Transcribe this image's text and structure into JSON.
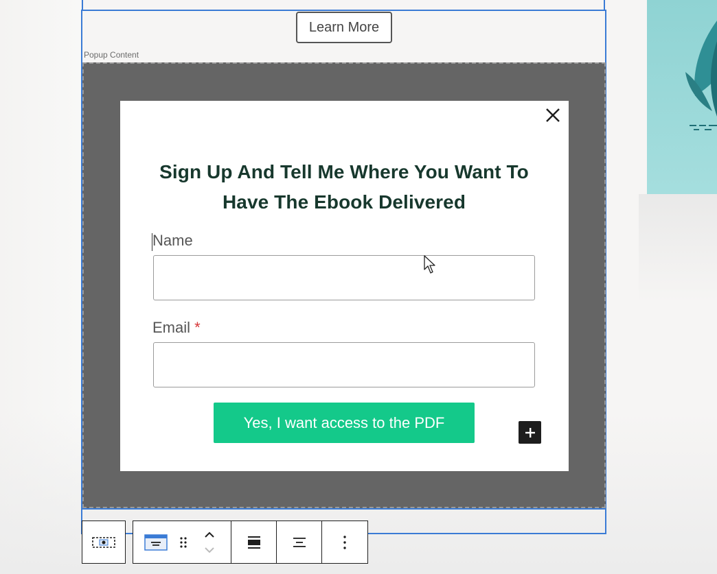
{
  "learn_more": {
    "label": "Learn More"
  },
  "popup_area": {
    "label": "Popup Content"
  },
  "modal": {
    "heading_line1": "Sign Up And Tell Me Where You Want To",
    "heading_line2": "Have The Ebook Delivered",
    "name_label": "Name",
    "name_value": "",
    "email_label": "Email",
    "email_required_marker": "*",
    "email_value": "",
    "submit_label": "Yes, I want access to the PDF"
  },
  "icons": {
    "close": "close-icon",
    "add_block": "plus-icon",
    "popup_block": "popup-block-icon",
    "block_type": "block-type-icon",
    "drag": "drag-handle-icon",
    "move_up": "chevron-up-icon",
    "move_down": "chevron-down-icon",
    "align_full": "align-full-icon",
    "justify": "justify-icon",
    "more": "more-options-icon"
  },
  "colors": {
    "accent": "#3a7bd5",
    "submit": "#14c98a",
    "heading": "#17382d",
    "required": "#d63638",
    "popup_backdrop": "#656565"
  }
}
